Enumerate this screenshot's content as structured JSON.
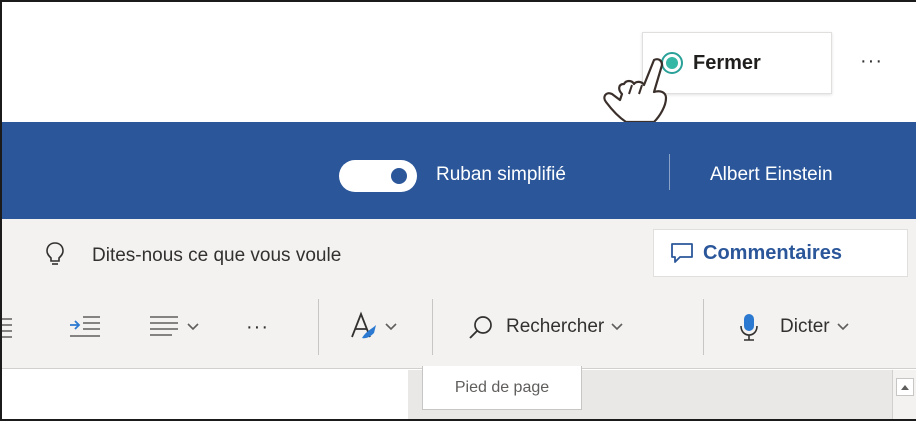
{
  "topbar": {
    "close_label": "Fermer",
    "more_label": "···"
  },
  "header": {
    "ribbon_toggle_label": "Ruban simplifié",
    "ribbon_toggle_on": true,
    "user_name": "Albert Einstein",
    "colors": {
      "brand": "#2b579a",
      "focus": "#35b7a5"
    }
  },
  "search": {
    "placeholder": "Dites-nous ce que vous voule",
    "comments_label": "Commentaires"
  },
  "toolbar": {
    "more_label": "···",
    "find_label": "Rechercher",
    "dictate_label": "Dicter",
    "icons": [
      "list-icon",
      "increase-indent-icon",
      "align-icon",
      "more-icon",
      "styles-icon",
      "search-icon",
      "microphone-icon"
    ]
  },
  "document": {
    "footer_tab_label": "Pied de page"
  }
}
